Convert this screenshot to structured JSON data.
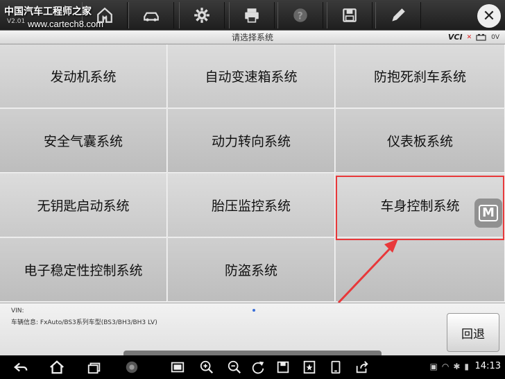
{
  "header": {
    "brand_overlay": "中国汽车工程师之家",
    "brand_url": "www.cartech8.com",
    "version": "V2.01",
    "toolbar_icons": [
      "home-icon",
      "vehicle-swap-icon",
      "settings-icon",
      "print-icon",
      "help-icon",
      "save-icon",
      "edit-icon"
    ],
    "close_symbol": "✕"
  },
  "title_bar": {
    "title": "请选择系统",
    "vci_label": "VCI",
    "vci_status": "✕",
    "battery_voltage": "0V"
  },
  "systems": [
    {
      "label": "发动机系统"
    },
    {
      "label": "自动变速箱系统"
    },
    {
      "label": "防抱死刹车系统"
    },
    {
      "label": "安全气囊系统"
    },
    {
      "label": "动力转向系统"
    },
    {
      "label": "仪表板系统"
    },
    {
      "label": "无钥匙启动系统"
    },
    {
      "label": "胎压监控系统"
    },
    {
      "label": "车身控制系统"
    },
    {
      "label": "电子稳定性控制系统"
    },
    {
      "label": "防盗系统"
    },
    {
      "label": ""
    }
  ],
  "highlight": {
    "target": "车身控制系统",
    "color": "#e8383a"
  },
  "floating_button": {
    "label": "M"
  },
  "footer": {
    "vin_label": "VIN:",
    "vehicle_info": "车辆信息: FxAuto/BS3系列车型(BS3/BH3/BH3 LV)",
    "back_label": "回退"
  },
  "navbar": {
    "clock": "14:13"
  }
}
